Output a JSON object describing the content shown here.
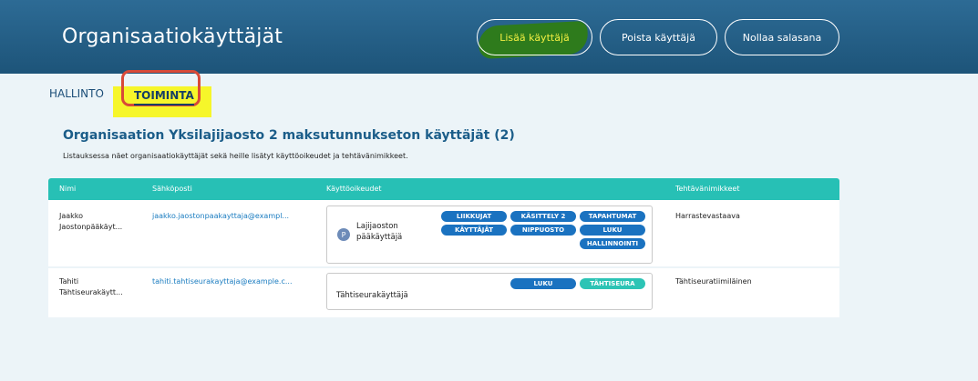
{
  "header": {
    "title": "Organisaatiokäyttäjät",
    "buttons": {
      "add": "Lisää käyttäjä",
      "remove": "Poista käyttäjä",
      "reset": "Nollaa salasana"
    }
  },
  "tabs": {
    "hallinto": "HALLINTO",
    "toiminta": "TOIMINTA"
  },
  "section": {
    "title": "Organisaation Yksilajijaosto 2 maksutunnukseton käyttäjät (2)",
    "description": "Listauksessa näet organisaatiokäyttäjät sekä heille lisätyt käyttöoikeudet ja tehtävänimikkeet."
  },
  "table": {
    "columns": {
      "name": "Nimi",
      "email": "Sähköposti",
      "permissions": "Käyttöoikeudet",
      "titles": "Tehtävänimikkeet"
    },
    "rows": [
      {
        "name_line1": "Jaakko",
        "name_line2": "Jaostonpääkäyt...",
        "email": "jaakko.jaostonpaakayttaja@exampl...",
        "avatar": "P",
        "role_line1": "Lajijaoston",
        "role_line2": "pääkäyttäjä",
        "badges": [
          "LIIKKUJAT",
          "KÄSITTELY 2",
          "TAPAHTUMAT",
          "KÄYTTÄJÄT",
          "NIPPUOSTO",
          "LUKU",
          "HALLINNOINTI"
        ],
        "title": "Harrastevastaava"
      },
      {
        "name_line1": "Tahiti",
        "name_line2": "Tähtiseurakäytt...",
        "email": "tahiti.tahtiseurakayttaja@example.c...",
        "role": "Tähtiseurakäyttäjä",
        "badges": [
          "LUKU",
          "TÄHTISEURA"
        ],
        "title": "Tähtiseuratiimiläinen"
      }
    ]
  },
  "colors": {
    "header": "#1f5a82",
    "table_header": "#27c0b5",
    "badge_blue": "#1a72c0",
    "badge_teal": "#2cc4b5",
    "highlight_yellow": "#f6f62a",
    "highlight_green": "#2e7b1c",
    "annotation_red": "#d84a38"
  }
}
